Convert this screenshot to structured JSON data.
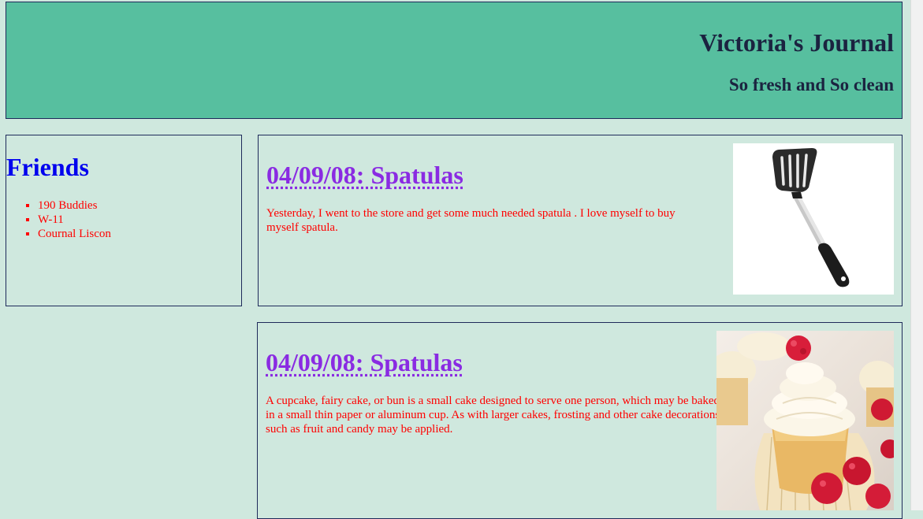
{
  "header": {
    "title": "Victoria's Journal",
    "subtitle": "So fresh and So clean"
  },
  "sidebar": {
    "heading": "Friends",
    "items": [
      {
        "label": "190 Buddies"
      },
      {
        "label": "W-11"
      },
      {
        "label": "Cournal Liscon"
      }
    ]
  },
  "posts": [
    {
      "title": "04/09/08: Spatulas",
      "body": "Yesterday, I went to the store and get some much needed spatula . I love myself to buy myself spatula.",
      "image_icon": "spatula-image"
    },
    {
      "title": "04/09/08: Spatulas",
      "body": "A cupcake, fairy cake, or bun is a small cake designed to serve one person, which may be baked in a small thin paper or aluminum cup. As with larger cakes, frosting and other cake decorations such as fruit and candy may be applied.",
      "image_icon": "cupcake-image"
    }
  ],
  "colors": {
    "background": "#cfe8de",
    "header_bg": "#57bf9f",
    "border": "#1e2a5a",
    "heading_blue": "#0000ee",
    "post_title": "#8a2be2",
    "body_text": "#ff0000"
  }
}
